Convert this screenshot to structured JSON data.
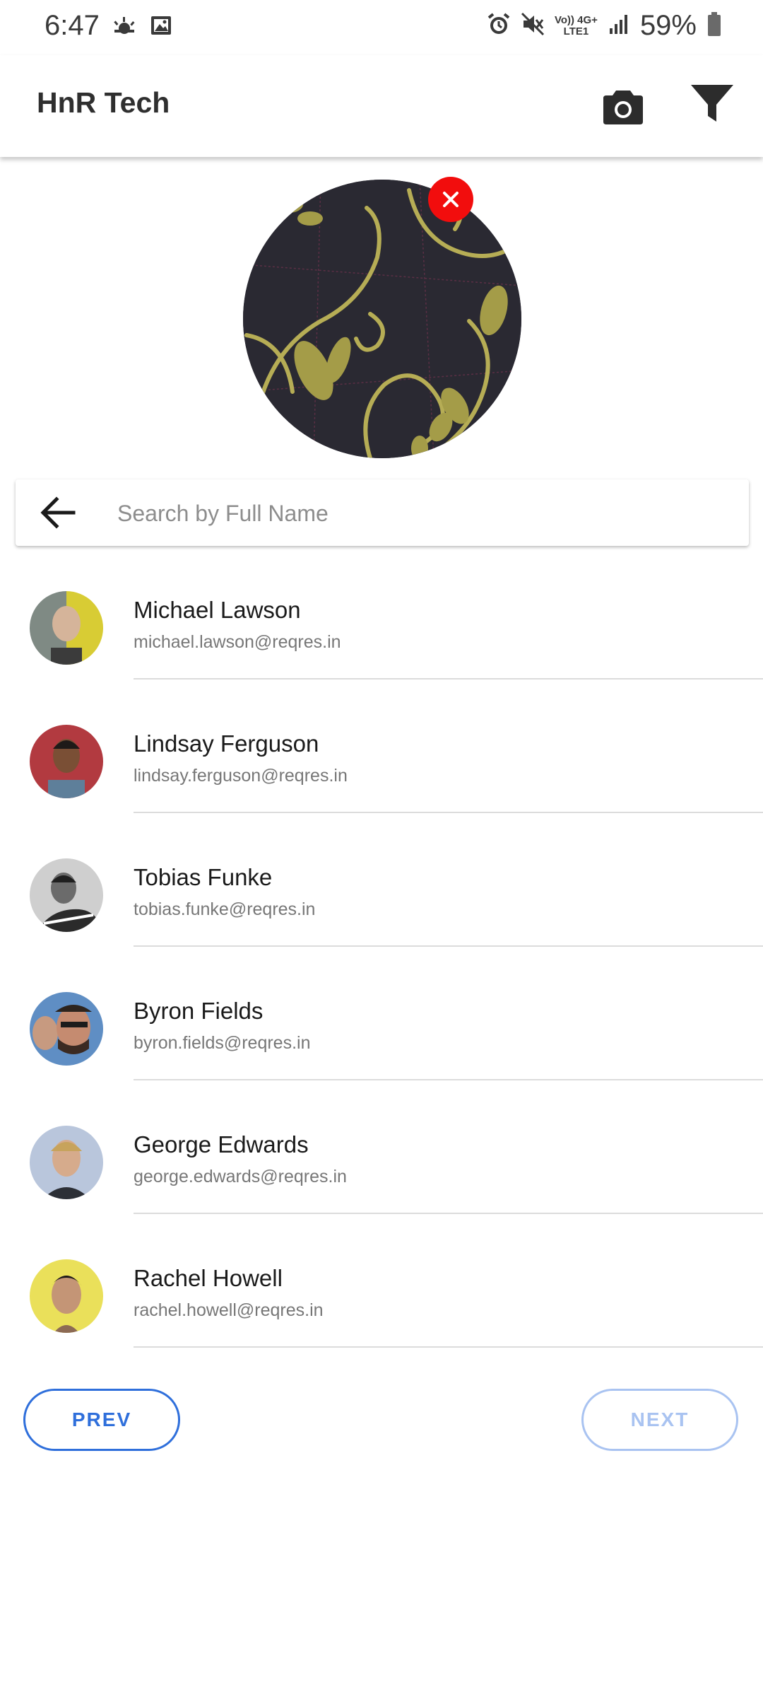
{
  "status_bar": {
    "time": "6:47",
    "battery_percent": "59%",
    "network_top": "Vo)) 4G+",
    "network_bottom": "LTE1",
    "icons": [
      "weather-icon",
      "gallery-icon",
      "alarm-icon",
      "mute-icon",
      "volte-icon",
      "signal-icon",
      "battery-icon"
    ]
  },
  "app_bar": {
    "title": "HnR Tech",
    "actions": [
      "camera-icon",
      "filter-icon"
    ]
  },
  "photo_preview": {
    "remove_icon": "close-icon",
    "remove_color": "#f20d0d"
  },
  "search": {
    "placeholder": "Search by Full Name",
    "value": "",
    "back_icon": "arrow-left-icon"
  },
  "users": [
    {
      "name": "Michael Lawson",
      "email": "michael.lawson@reqres.in"
    },
    {
      "name": "Lindsay Ferguson",
      "email": "lindsay.ferguson@reqres.in"
    },
    {
      "name": "Tobias Funke",
      "email": "tobias.funke@reqres.in"
    },
    {
      "name": "Byron Fields",
      "email": "byron.fields@reqres.in"
    },
    {
      "name": "George Edwards",
      "email": "george.edwards@reqres.in"
    },
    {
      "name": "Rachel Howell",
      "email": "rachel.howell@reqres.in"
    }
  ],
  "pagination": {
    "prev_label": "PREV",
    "next_label": "NEXT",
    "next_enabled": false
  },
  "colors": {
    "accent": "#2f6fdb",
    "accent_disabled": "#a9c3f1",
    "remove": "#f20d0d"
  }
}
